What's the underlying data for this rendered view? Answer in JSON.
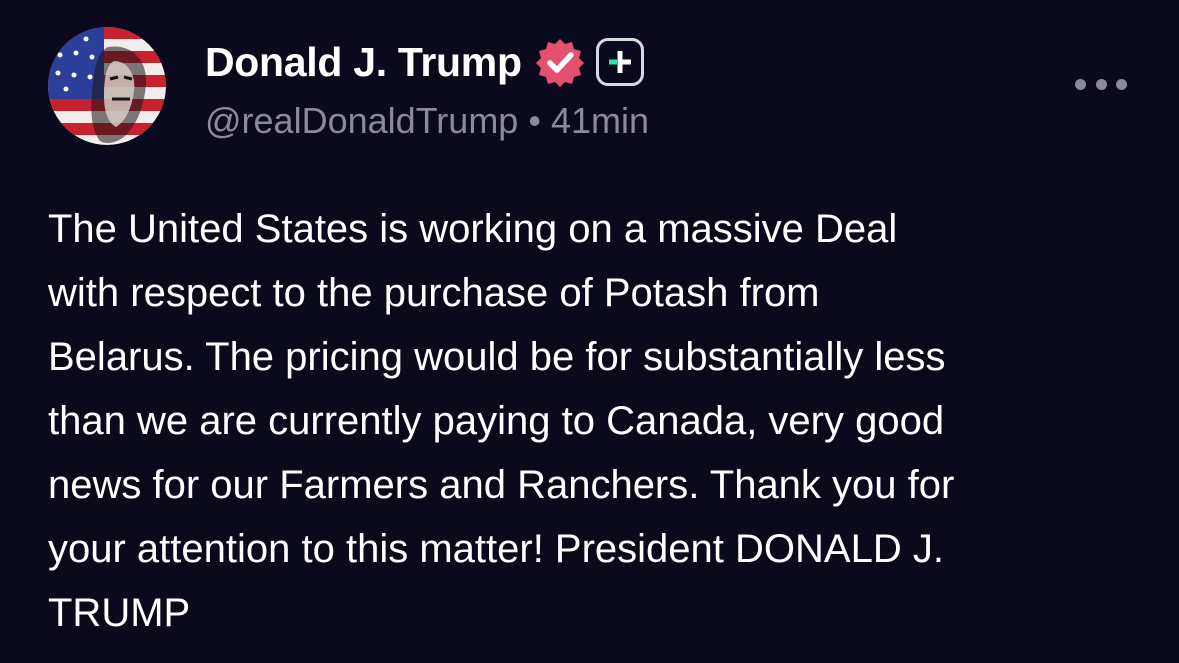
{
  "post": {
    "author": {
      "display_name": "Donald J. Trump",
      "handle": "@realDonaldTrump",
      "verified_icon": "verified-check-badge-icon",
      "subscription_icon": "plus-badge-icon"
    },
    "separator": "•",
    "timestamp": "41min",
    "menu_icon": "more-horizontal-icon",
    "body_lines": [
      "The United States is working on a massive Deal",
      "with respect to the purchase of Potash from",
      "Belarus. The pricing would be for substantially less",
      "than we are currently paying to Canada, very good",
      "news for our Farmers and Ranchers. Thank you for",
      "your attention to this matter! President DONALD J.",
      "TRUMP"
    ]
  },
  "colors": {
    "background": "#0b0a1c",
    "text_primary": "#ffffff",
    "text_secondary": "#8b8a99",
    "verified_badge": "#e4516f",
    "plus_accent": "#2ee6a6"
  }
}
